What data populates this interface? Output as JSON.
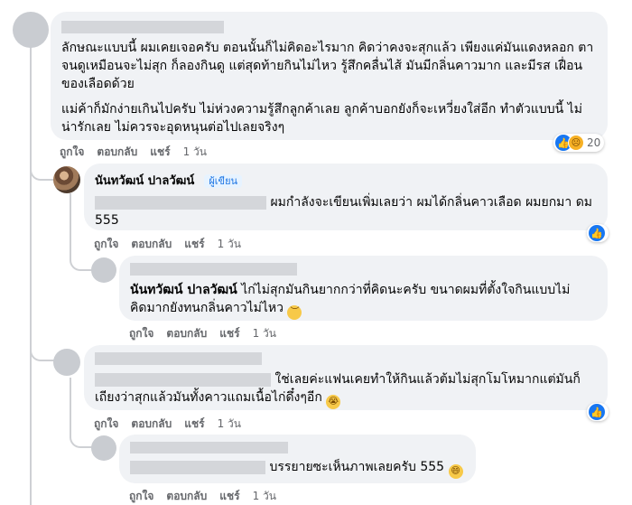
{
  "reaction_colors": {
    "like": "#1877f2",
    "sad": "#f7b125"
  },
  "actions": {
    "like": "ถูกใจ",
    "reply": "ตอบกลับ",
    "share": "แชร์",
    "time": "1 วัน"
  },
  "comments": [
    {
      "author_redacted": true,
      "paragraphs": [
        "ลักษณะแบบนี้ ผมเคยเจอครับ ตอนนั้นก็ไม่คิดอะไรมาก คิดว่าคงจะสุกแล้ว เพียงแค่มันแดงหลอก ตาจนดูเหมือนจะไม่สุก ก็ลองกินดู แต่สุดท้ายกินไม่ไหว รู้สึกคลื่นไส้ มันมีกลิ่นคาวมาก และมีรส เฝื่อนของเลือดด้วย",
        "แม่ค้าก็มักง่ายเกินไปครับ ไม่ห่วงความรู้สึกลูกค้าเลย ลูกค้าบอกยังก็จะเหวี่ยงใส่อีก ทำตัวแบบนี้ ไม่น่ารักเลย ไม่ควรจะอุดหนุนต่อไปเลยจริงๆ"
      ],
      "reactions": {
        "icons": [
          "like-icon",
          "sad-icon"
        ],
        "count": "20"
      }
    },
    {
      "author": "นันทวัฒน์ ปาลวัฒน์",
      "badge": "ผู้เขียน",
      "text": "ผมกำลังจะเขียนเพิ่มเลยว่า ผมได้กลิ่นคาวเลือด ผมยกมา ดม 555",
      "reactions": {
        "icons": [
          "like-icon"
        ]
      }
    },
    {
      "author_redacted": true,
      "mention": "นันทวัฒน์ ปาลวัฒน์",
      "text": "ไก่ไม่สุกมันกินยากกว่าที่คิดนะครับ ขนาดผมที่ตั้งใจกินแบบไม่ คิดมากยังทนกลิ่นคาวไม่ไหว",
      "emoji": "downcast-face-icon"
    },
    {
      "author_redacted": true,
      "text": "ใช่เลยค่ะแฟนเคยทำให้กินแล้วต้มไม่สุกโมโหมากแต่มันก็ เถียงว่าสุกแล้วมันทั้งคาวแถมเนื้อไก่ดึ๋งๆอีก",
      "emoji": "crying-face-icon",
      "reactions": {
        "icons": [
          "like-icon"
        ]
      }
    },
    {
      "author_redacted": true,
      "text": "บรรยายซะเห็นภาพเลยครับ 555",
      "emoji": "grinning-face-icon"
    }
  ]
}
